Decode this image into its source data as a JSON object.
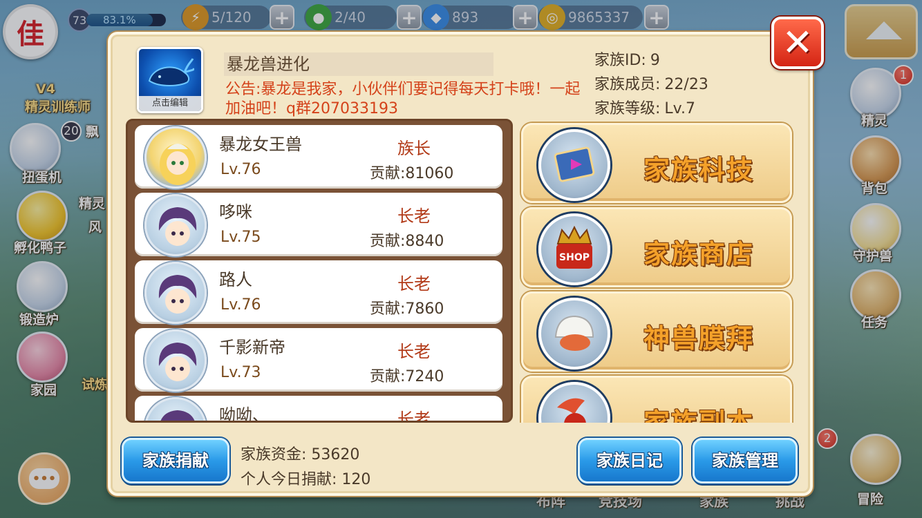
{
  "hud": {
    "player_badge": "佳",
    "player_level": "73",
    "exp_percent": "83.1%",
    "exp_fraction": 0.831,
    "stamina": "5/120",
    "energy": "2/40",
    "diamonds": "893",
    "gold": "9865337",
    "plus": "+"
  },
  "side_left": {
    "vip": "V4",
    "trainer": "精灵训练师",
    "gacha_badge": "20",
    "gacha_tag": "飘",
    "gacha": "扭蛋机",
    "spirit": "精灵",
    "wind": "风",
    "hatch": "孵化鸭子",
    "forge": "锻造炉",
    "home": "家园",
    "trial": "试炼"
  },
  "side_right": {
    "spirit_badge": "1",
    "spirit": "精灵",
    "bag": "背包",
    "guardian": "守护兽",
    "quest": "任务",
    "battle_badge": "2",
    "adventure": "冒险"
  },
  "bottom_nav": [
    "布阵",
    "竞技场",
    "家族",
    "挑战"
  ],
  "family": {
    "logo_caption": "点击编辑",
    "name": "暴龙兽进化",
    "announcement": "公告:暴龙是我家，小伙伴们要记得每天打卡哦！一起加油吧！q群207033193",
    "id_label": "家族ID:",
    "id_value": "9",
    "members_label": "家族成员:",
    "members_value": "22/23",
    "level_label": "家族等级:",
    "level_value": "Lv.7"
  },
  "members": [
    {
      "name": "暴龙女王兽",
      "level": "Lv.76",
      "rank": "族长",
      "contrib": "贡献:81060"
    },
    {
      "name": "哆咪",
      "level": "Lv.75",
      "rank": "长老",
      "contrib": "贡献:8840"
    },
    {
      "name": "路人",
      "level": "Lv.76",
      "rank": "长老",
      "contrib": "贡献:7860"
    },
    {
      "name": "千影新帝",
      "level": "Lv.73",
      "rank": "长老",
      "contrib": "贡献:7240"
    },
    {
      "name": "呦呦、",
      "level": "",
      "rank": "长老",
      "contrib": ""
    }
  ],
  "functions": [
    {
      "label": "家族科技",
      "icon": "tech-book-icon"
    },
    {
      "label": "家族商店",
      "icon": "shop-crown-icon"
    },
    {
      "label": "神兽膜拜",
      "icon": "beast-helmet-icon"
    },
    {
      "label": "家族副本",
      "icon": "winged-dungeon-icon"
    }
  ],
  "bottom": {
    "donate_button": "家族捐献",
    "fund_label": "家族资金:",
    "fund_value": "53620",
    "today_label": "个人今日捐献:",
    "today_value": "120",
    "diary_button": "家族日记",
    "manage_button": "家族管理"
  },
  "close": "✕"
}
